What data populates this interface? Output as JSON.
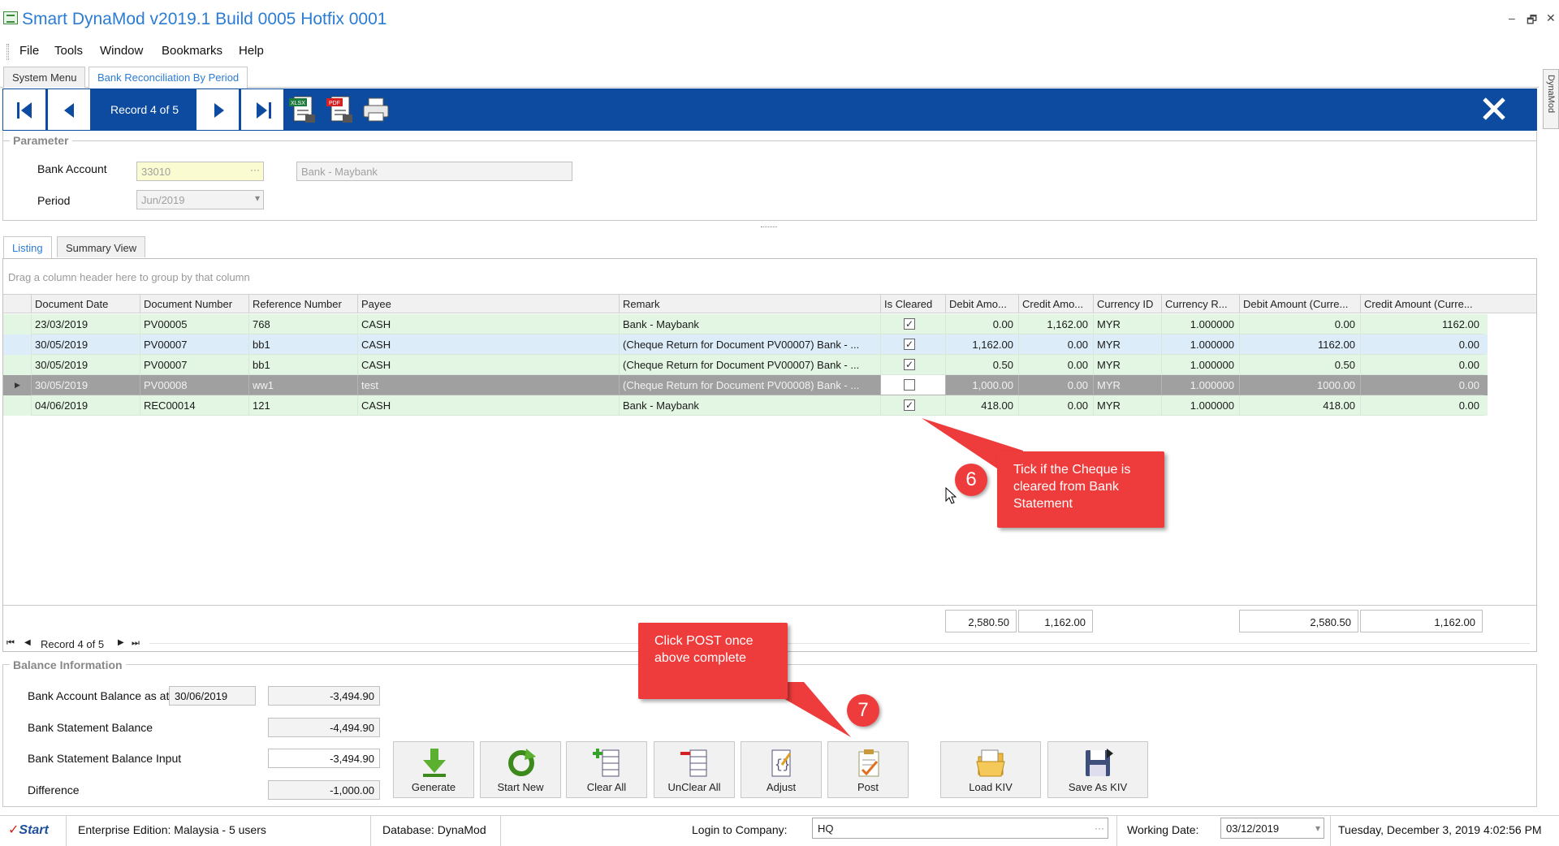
{
  "window": {
    "title": "Smart DynaMod v2019.1 Build 0005 Hotfix 0001",
    "controls": [
      "–",
      "🗗",
      "✕"
    ]
  },
  "menu": [
    "File",
    "Tools",
    "Window",
    "Bookmarks",
    "Help"
  ],
  "doc_tabs": [
    "System Menu",
    "Bank Reconciliation By Period"
  ],
  "toolbar": {
    "record_label": "Record 4 of 5",
    "icons": [
      "first-record-icon",
      "previous-record-icon",
      "next-record-icon",
      "last-record-icon",
      "export-xlsx-icon",
      "export-pdf-icon",
      "print-icon",
      "close-icon"
    ],
    "xlsx_badge": "XLSX",
    "pdf_badge": "PDF"
  },
  "right_rail": {
    "label": "DynaMod"
  },
  "parameter": {
    "title": "Parameter",
    "bank_account_label": "Bank Account",
    "bank_account_code": "33010",
    "bank_account_name": "Bank - Maybank",
    "period_label": "Period",
    "period_value": "Jun/2019"
  },
  "listing_tabs": [
    "Listing",
    "Summary View"
  ],
  "grid": {
    "group_hint": "Drag a column header here to group by that column",
    "columns": [
      "Document Date",
      "Document Number",
      "Reference Number",
      "Payee",
      "Remark",
      "Is Cleared",
      "Debit Amo...",
      "Credit Amo...",
      "Currency ID",
      "Currency R...",
      "Debit Amount (Curre...",
      "Credit Amount (Curre..."
    ],
    "rows": [
      {
        "date": "23/03/2019",
        "doc": "PV00005",
        "ref": "768",
        "payee": "CASH",
        "remark": "Bank - Maybank",
        "cleared": true,
        "debit": "0.00",
        "credit": "1,162.00",
        "currency": "MYR",
        "rate": "1.000000",
        "debit_cur": "0.00",
        "credit_cur": "1162.00",
        "style": "green"
      },
      {
        "date": "30/05/2019",
        "doc": "PV00007",
        "ref": "bb1",
        "payee": "CASH",
        "remark": "(Cheque Return for Document PV00007) Bank - ...",
        "cleared": true,
        "debit": "1,162.00",
        "credit": "0.00",
        "currency": "MYR",
        "rate": "1.000000",
        "debit_cur": "1162.00",
        "credit_cur": "0.00",
        "style": "blue"
      },
      {
        "date": "30/05/2019",
        "doc": "PV00007",
        "ref": "bb1",
        "payee": "CASH",
        "remark": "(Cheque Return for Document PV00007) Bank - ...",
        "cleared": true,
        "debit": "0.50",
        "credit": "0.00",
        "currency": "MYR",
        "rate": "1.000000",
        "debit_cur": "0.50",
        "credit_cur": "0.00",
        "style": "green"
      },
      {
        "date": "30/05/2019",
        "doc": "PV00008",
        "ref": "ww1",
        "payee": "test",
        "remark": "(Cheque Return for Document PV00008) Bank - ...",
        "cleared": false,
        "debit": "1,000.00",
        "credit": "0.00",
        "currency": "MYR",
        "rate": "1.000000",
        "debit_cur": "1000.00",
        "credit_cur": "0.00",
        "style": "selected"
      },
      {
        "date": "04/06/2019",
        "doc": "REC00014",
        "ref": "121",
        "payee": "CASH",
        "remark": "Bank - Maybank",
        "cleared": true,
        "debit": "418.00",
        "credit": "0.00",
        "currency": "MYR",
        "rate": "1.000000",
        "debit_cur": "418.00",
        "credit_cur": "0.00",
        "style": "green"
      }
    ],
    "totals": {
      "debit": "2,580.50",
      "credit": "1,162.00",
      "debit_cur": "2,580.50",
      "credit_cur": "1,162.00"
    },
    "pager_label": "Record 4 of 5"
  },
  "balance": {
    "title": "Balance Information",
    "bank_account_balance_label": "Bank Account Balance as at",
    "as_at_date": "30/06/2019",
    "bank_account_balance": "-3,494.90",
    "statement_balance_label": "Bank Statement Balance",
    "statement_balance": "-4,494.90",
    "statement_input_label": "Bank Statement Balance Input",
    "statement_input": "-3,494.90",
    "difference_label": "Difference",
    "difference": "-1,000.00"
  },
  "actions": [
    "Generate",
    "Start New",
    "Clear All",
    "UnClear All",
    "Adjust",
    "Post",
    "Load KIV",
    "Save As KIV"
  ],
  "status": {
    "brand": "Start",
    "edition": "Enterprise Edition: Malaysia - 5 users",
    "database": "Database: DynaMod",
    "login_label": "Login to Company:",
    "company": "HQ",
    "working_date_label": "Working Date:",
    "working_date": "03/12/2019",
    "datetime": "Tuesday, December 3, 2019 4:02:56 PM"
  },
  "annotations": {
    "step6": {
      "badge": "6",
      "text": "Tick if the Cheque is cleared from Bank Statement"
    },
    "step7": {
      "badge": "7",
      "text": "Click POST once above complete"
    }
  },
  "colors": {
    "toolbar_blue": "#0d4ba0",
    "row_green": "#e3f6e3",
    "row_blue": "#dcecf8",
    "row_selected": "#a0a0a0",
    "accent": "#2b7cd3",
    "callout_red": "#ee3b3b"
  }
}
